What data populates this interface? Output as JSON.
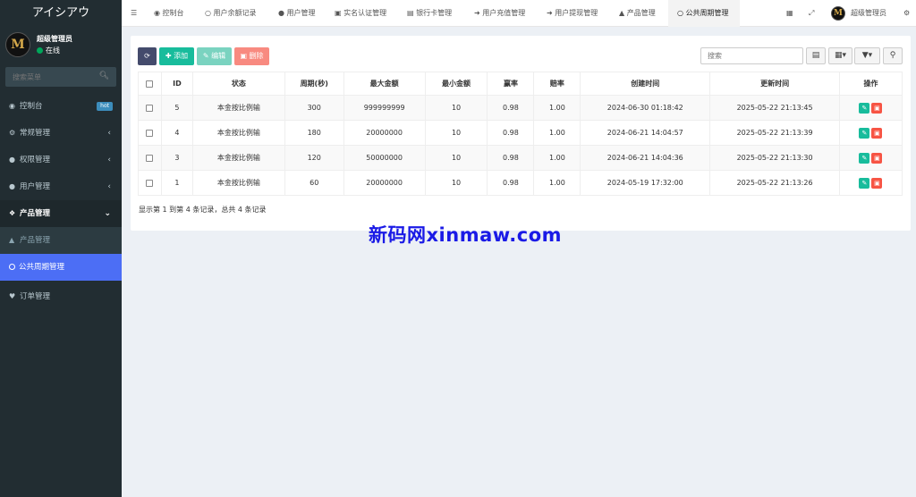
{
  "app": {
    "title": "アイシアウ"
  },
  "user": {
    "name": "超级管理员",
    "status": "在线",
    "avatar_letter": "M"
  },
  "sidebar": {
    "search_placeholder": "搜索菜单",
    "items": [
      {
        "label": "控制台",
        "badge": "hot"
      },
      {
        "label": "常规管理"
      },
      {
        "label": "权限管理"
      },
      {
        "label": "用户管理"
      },
      {
        "label": "产品管理"
      },
      {
        "label": "产品管理"
      },
      {
        "label": "公共周期管理"
      },
      {
        "label": "订单管理"
      }
    ]
  },
  "topbar": {
    "tabs": [
      "控制台",
      "用户余额记录",
      "用户管理",
      "实名认证管理",
      "银行卡管理",
      "用户充值管理",
      "用户提现管理",
      "产品管理",
      "公共周期管理"
    ],
    "user_name": "超级管理员"
  },
  "toolbar": {
    "add": "添加",
    "edit": "编辑",
    "delete": "删除",
    "search_placeholder": "搜索"
  },
  "table": {
    "headers": [
      "ID",
      "状态",
      "周期(秒)",
      "最大金额",
      "最小金额",
      "赢率",
      "赔率",
      "创建时间",
      "更新时间",
      "操作"
    ],
    "rows": [
      [
        "5",
        "本金按比例输",
        "300",
        "999999999",
        "10",
        "0.98",
        "1.00",
        "2024-06-30 01:18:42",
        "2025-05-22 21:13:45"
      ],
      [
        "4",
        "本金按比例输",
        "180",
        "20000000",
        "10",
        "0.98",
        "1.00",
        "2024-06-21 14:04:57",
        "2025-05-22 21:13:39"
      ],
      [
        "3",
        "本金按比例输",
        "120",
        "50000000",
        "10",
        "0.98",
        "1.00",
        "2024-06-21 14:04:36",
        "2025-05-22 21:13:30"
      ],
      [
        "1",
        "本金按比例输",
        "60",
        "20000000",
        "10",
        "0.98",
        "1.00",
        "2024-05-19 17:32:00",
        "2025-05-22 21:13:26"
      ]
    ]
  },
  "summary": "显示第 1 到第 4 条记录，总共 4 条记录",
  "watermark": "新码网xinmaw.com",
  "colors": {
    "sidebar": "#222d32",
    "active": "#4c6ef5",
    "add": "#18bc9c",
    "edit": "#7ad3c0",
    "delete": "#f88a80",
    "refresh": "#444b6c"
  }
}
